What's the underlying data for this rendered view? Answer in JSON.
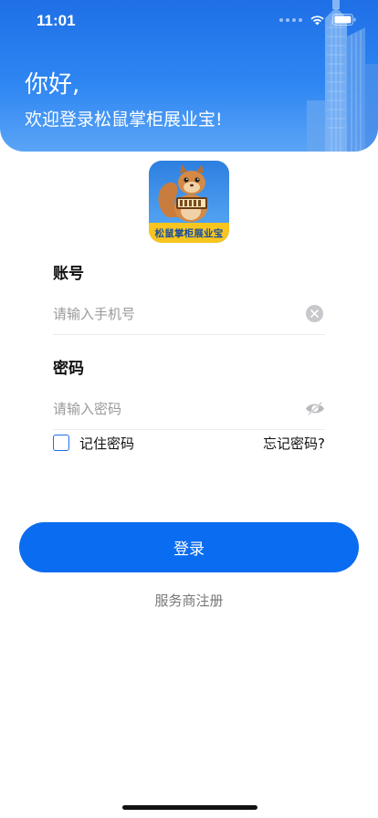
{
  "status_bar": {
    "time": "11:01"
  },
  "header": {
    "greeting": "你好,",
    "welcome": "欢迎登录松鼠掌柜展业宝!"
  },
  "logo": {
    "band_text": "松鼠掌柜展业宝"
  },
  "form": {
    "account": {
      "label": "账号",
      "placeholder": "请输入手机号",
      "value": ""
    },
    "password": {
      "label": "密码",
      "placeholder": "请输入密码",
      "value": ""
    }
  },
  "remember": {
    "label": "记住密码",
    "checked": false
  },
  "forgot": {
    "label": "忘记密码?"
  },
  "login": {
    "label": "登录"
  },
  "register": {
    "label": "服务商注册"
  },
  "colors": {
    "primary": "#0a6cf0",
    "header_top": "#1f6fe6",
    "logo_band": "#f7c51e"
  },
  "icons": [
    "wifi-icon",
    "battery-icon",
    "clear-icon",
    "eye-closed-icon",
    "checkbox-icon",
    "squirrel-logo-icon"
  ]
}
